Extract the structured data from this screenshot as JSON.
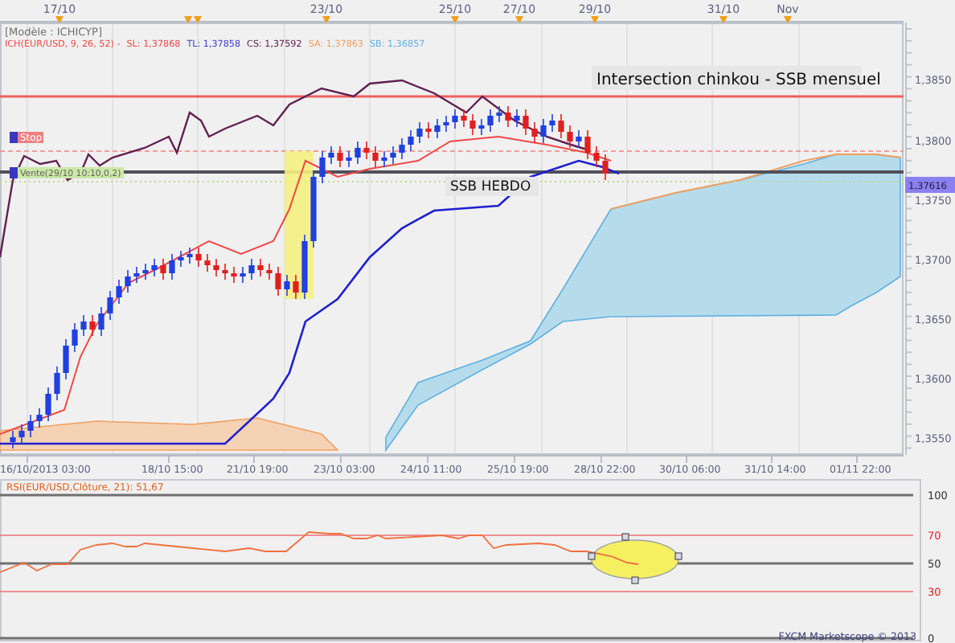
{
  "top_axis": {
    "labels": [
      "17/10",
      "23/10",
      "25/10",
      "27/10",
      "29/10",
      "31/10",
      "Nov"
    ]
  },
  "header": {
    "model": "[Modèle : ICHICYP]",
    "indicator": "ICH(EUR/USD, 9, 26, 52) -",
    "values": [
      {
        "label": "SL: 1,37868",
        "color": "#f04848"
      },
      {
        "label": "TL: 1,37858",
        "color": "#4040d0"
      },
      {
        "label": "CS: 1,37592",
        "color": "#602050"
      },
      {
        "label": "SA: 1,37863",
        "color": "#f0a060"
      },
      {
        "label": "SB: 1,36857",
        "color": "#60b0e0"
      }
    ]
  },
  "annotations": [
    {
      "text": "Intersection chinkou - SSB mensuel"
    },
    {
      "text": "SSB HEBDO"
    }
  ],
  "orders": [
    {
      "label": "Stop",
      "kind": "stop"
    },
    {
      "label": "Vente(29/10 10:10,0,2)",
      "kind": "entry"
    }
  ],
  "price_axis": {
    "labels": [
      "1,3850",
      "1,3800",
      "1,3750",
      "1,3700",
      "1,3650",
      "1,3600",
      "1,3550"
    ],
    "current_price": "1,37616"
  },
  "time_axis": {
    "labels": [
      "16/10/2013 03:00",
      "18/10 15:00",
      "21/10 19:00",
      "23/10 03:00",
      "24/10 11:00",
      "25/10 19:00",
      "28/10 22:00",
      "30/10 06:00",
      "31/10 14:00",
      "01/11 22:00"
    ]
  },
  "rsi": {
    "label": "RSI(EUR/USD,Clôture, 21): 51,67",
    "axis": [
      "100",
      "70",
      "50",
      "30",
      "0"
    ]
  },
  "footer": "FXCM Marketscope © 2013"
}
